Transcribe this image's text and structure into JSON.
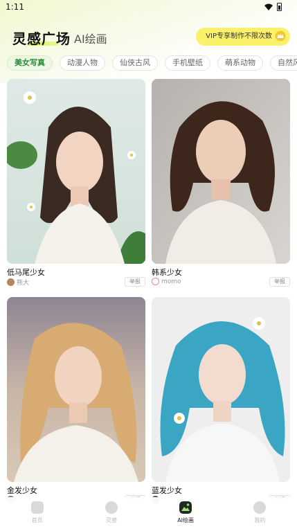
{
  "status_bar": {
    "time": "1:11",
    "icons": [
      "wifi-icon",
      "battery-icon"
    ]
  },
  "header": {
    "title": "灵感广场",
    "subtitle": "AI绘画",
    "vip_banner": "VIP专享制作不限次数",
    "vip_icon": "crown-icon"
  },
  "colors": {
    "accent_green": "#2f8a3b",
    "vip_yellow": "#fbf06a",
    "title_highlight": "#c9ec3d"
  },
  "categories": [
    {
      "label": "美女写真",
      "active": true
    },
    {
      "label": "动漫人物",
      "active": false
    },
    {
      "label": "仙侠古风",
      "active": false
    },
    {
      "label": "手机壁纸",
      "active": false
    },
    {
      "label": "萌系动物",
      "active": false
    },
    {
      "label": "自然风景",
      "active": false
    }
  ],
  "cards": [
    {
      "title": "低马尾少女",
      "author": "熊大",
      "report": "举报"
    },
    {
      "title": "韩系少女",
      "author": "momo",
      "report": "举报"
    },
    {
      "title": "金发少女",
      "author": "",
      "report": "举报"
    },
    {
      "title": "蓝发少女",
      "author": "",
      "report": "举报"
    }
  ],
  "bottom_nav": [
    {
      "label": "首页",
      "icon": "home-icon",
      "active": false
    },
    {
      "label": "灵感",
      "icon": "inspiration-icon",
      "active": false
    },
    {
      "label": "AI绘画",
      "icon": "ai-painting-icon",
      "active": true
    },
    {
      "label": "我的",
      "icon": "profile-icon",
      "active": false
    }
  ]
}
